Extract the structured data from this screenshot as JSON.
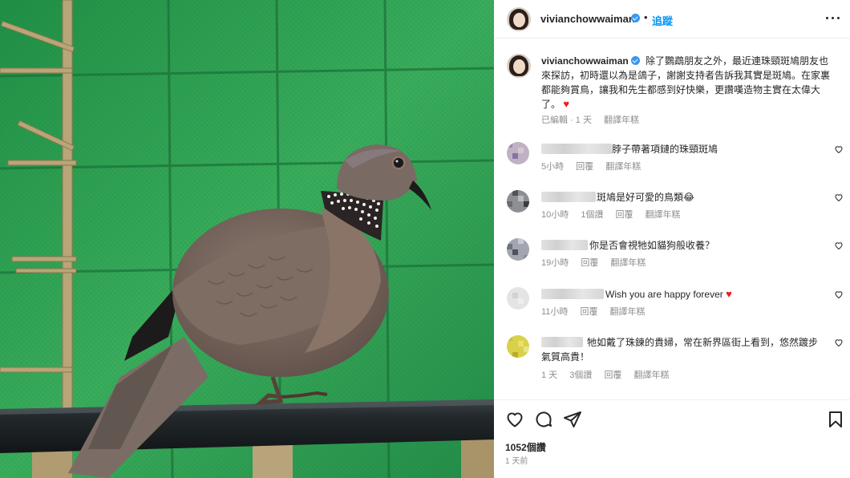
{
  "post": {
    "username": "vivianchowwaiman",
    "follow_label": "追蹤",
    "caption": "除了鸚鵡朋友之外，最近連珠頸斑鳩朋友也來探訪，初時還以為是鴿子，謝謝支持者告訴我其實是斑鳩。在家裏都能夠賞鳥，讓我和先生都感到好快樂，更讚嘆造物主實在太偉大了。",
    "caption_emoji": "♥",
    "edited_label": "已編輯 · 1 天",
    "translate_label": "翻譯年糕",
    "likes": "1052個讚",
    "time_ago": "1 天前"
  },
  "comments": [
    {
      "text": "脖子帶著項鏈的珠頸斑鳩",
      "time": "5小時",
      "likes": "",
      "reply": "回覆",
      "translate": "翻譯年糕"
    },
    {
      "text": "斑鳩是好可愛的鳥類😂",
      "time": "10小時",
      "likes": "1個讚",
      "reply": "回覆",
      "translate": "翻譯年糕"
    },
    {
      "text": "你是否會視牠如貓狗般收養？",
      "time": "19小時",
      "likes": "",
      "reply": "回覆",
      "translate": "翻譯年糕"
    },
    {
      "text": "Wish you are happy forever",
      "emoji": "♥",
      "time": "11小時",
      "likes": "",
      "reply": "回覆",
      "translate": "翻譯年糕"
    },
    {
      "text": "牠如戴了珠鍊的貴婦，常在新界區街上看到，悠然踱步氣質高貴！",
      "time": "1 天",
      "likes": "3個讚",
      "reply": "回覆",
      "translate": "翻譯年糕"
    }
  ],
  "icons": {
    "like": "heart-icon",
    "comment": "comment-bubble-icon",
    "share": "paper-plane-icon",
    "save": "bookmark-icon",
    "more": "more-dots-icon",
    "verified": "verified-badge-icon"
  },
  "colors": {
    "accent": "#0095f6",
    "verified": "#3897f0",
    "heart": "#ed1c24",
    "meta": "#8e8e8e"
  }
}
